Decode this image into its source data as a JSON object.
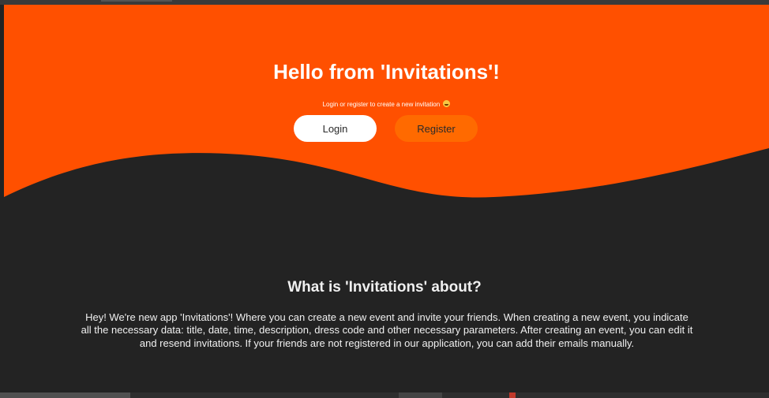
{
  "hero": {
    "title": "Hello from 'Invitations'!",
    "subtitle": "Login or register to create a new invitation",
    "emoji_icon": "grinning-face-icon",
    "login_label": "Login",
    "register_label": "Register",
    "accent_color": "#ff5000",
    "register_color": "#ff6a00"
  },
  "about": {
    "title": "What is 'Invitations' about?",
    "text": "Hey! We're new app 'Invitations'! Where you can create a new event and invite your friends. When creating a new event, you indicate all the necessary data: title, date, time, description, dress code and other necessary parameters. After creating an event, you can edit it and resend invitations. If your friends are not registered in our application, you can add their emails manually."
  },
  "colors": {
    "background": "#232323",
    "text": "#f0f0f0"
  }
}
